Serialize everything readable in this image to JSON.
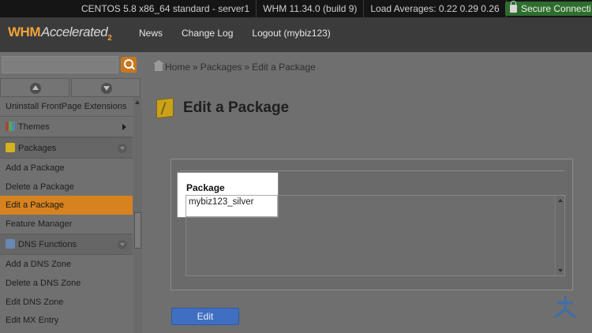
{
  "statusbar": {
    "os": "CENTOS 5.8 x86_64 standard - server1",
    "whm_version": "WHM 11.34.0 (build 9)",
    "load": "Load Averages: 0.22 0.29 0.26",
    "secure": "Secure Connecti"
  },
  "header": {
    "logo_main": "WHM",
    "logo_accent": "Accelerated",
    "logo_sub": "2",
    "nav": [
      "News",
      "Change Log",
      "Logout (mybiz123)"
    ]
  },
  "sidebar": {
    "search_placeholder": "",
    "items": [
      {
        "label": "Uninstall FrontPage Extensions"
      },
      {
        "label": "Themes"
      },
      {
        "label": "Packages"
      },
      {
        "label": "Add a Package"
      },
      {
        "label": "Delete a Package"
      },
      {
        "label": "Edit a Package"
      },
      {
        "label": "Feature Manager"
      },
      {
        "label": "DNS Functions"
      },
      {
        "label": "Add a DNS Zone"
      },
      {
        "label": "Delete a DNS Zone"
      },
      {
        "label": "Edit DNS Zone"
      },
      {
        "label": "Edit MX Entry"
      }
    ]
  },
  "breadcrumb": {
    "home": "Home",
    "sep": "»",
    "packages": "Packages",
    "current": "Edit a Package"
  },
  "main": {
    "title": "Edit a Package",
    "package_label": "Package",
    "package_value": "mybiz123_silver",
    "edit_button": "Edit"
  }
}
